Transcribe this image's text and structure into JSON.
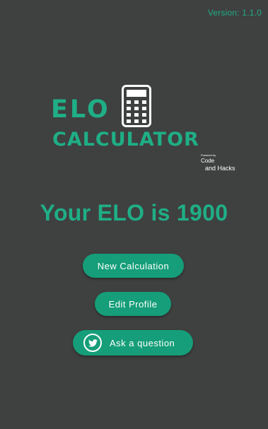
{
  "header": {
    "version": "Version: 1.1.0"
  },
  "logo": {
    "line1": "ELO",
    "line2": "CALCULATOR",
    "powered_by": "Powered by",
    "brand_line1": "Code",
    "brand_line2": "and Hacks",
    "icon": "calculator-icon"
  },
  "main": {
    "elo_text": "Your ELO is 1900"
  },
  "buttons": {
    "new_calculation": "New Calculation",
    "edit_profile": "Edit Profile",
    "ask_question": "Ask a question",
    "ask_icon": "twitter-icon"
  },
  "colors": {
    "background": "#3f4040",
    "accent": "#1fae86",
    "button": "#159e79"
  }
}
